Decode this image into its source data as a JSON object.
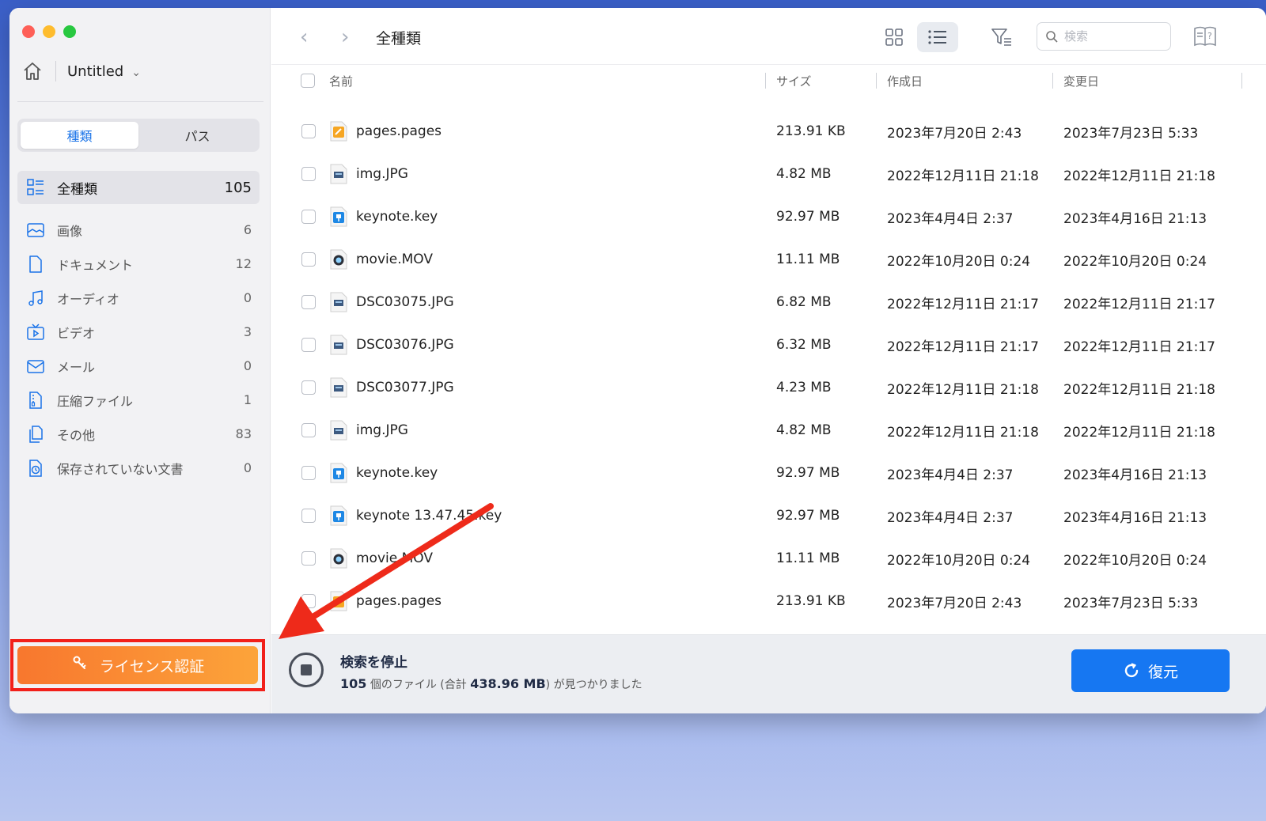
{
  "window": {
    "title": "Untitled"
  },
  "sidebar": {
    "segments": [
      {
        "label": "種類",
        "active": true
      },
      {
        "label": "パス",
        "active": false
      }
    ],
    "categories": [
      {
        "label": "全種類",
        "count": "105",
        "icon": "all-types-icon"
      },
      {
        "label": "画像",
        "count": "6",
        "icon": "image-icon"
      },
      {
        "label": "ドキュメント",
        "count": "12",
        "icon": "document-icon"
      },
      {
        "label": "オーディオ",
        "count": "0",
        "icon": "music-note-icon"
      },
      {
        "label": "ビデオ",
        "count": "3",
        "icon": "video-icon"
      },
      {
        "label": "メール",
        "count": "0",
        "icon": "mail-icon"
      },
      {
        "label": "圧縮ファイル",
        "count": "1",
        "icon": "archive-icon"
      },
      {
        "label": "その他",
        "count": "83",
        "icon": "other-files-icon"
      },
      {
        "label": "保存されていない文書",
        "count": "0",
        "icon": "unsaved-document-icon"
      }
    ],
    "license_label": "ライセンス認証"
  },
  "toolbar": {
    "breadcrumb": "全種類",
    "search_placeholder": "検索"
  },
  "table": {
    "headers": {
      "name": "名前",
      "size": "サイズ",
      "created": "作成日",
      "modified": "変更日"
    },
    "rows": [
      {
        "name": "pages.pages",
        "size": "213.91 KB",
        "created": "2023年7月20日 2:43",
        "modified": "2023年7月23日 5:33",
        "type": "pages"
      },
      {
        "name": "img.JPG",
        "size": "4.82 MB",
        "created": "2022年12月11日 21:18",
        "modified": "2022年12月11日 21:18",
        "type": "image"
      },
      {
        "name": "keynote.key",
        "size": "92.97 MB",
        "created": "2023年4月4日 2:37",
        "modified": "2023年4月16日 21:13",
        "type": "keynote"
      },
      {
        "name": "movie.MOV",
        "size": "11.11 MB",
        "created": "2022年10月20日 0:24",
        "modified": "2022年10月20日 0:24",
        "type": "movie"
      },
      {
        "name": "DSC03075.JPG",
        "size": "6.82 MB",
        "created": "2022年12月11日 21:17",
        "modified": "2022年12月11日 21:17",
        "type": "image"
      },
      {
        "name": "DSC03076.JPG",
        "size": "6.32 MB",
        "created": "2022年12月11日 21:17",
        "modified": "2022年12月11日 21:17",
        "type": "image"
      },
      {
        "name": "DSC03077.JPG",
        "size": "4.23 MB",
        "created": "2022年12月11日 21:18",
        "modified": "2022年12月11日 21:18",
        "type": "image"
      },
      {
        "name": "img.JPG",
        "size": "4.82 MB",
        "created": "2022年12月11日 21:18",
        "modified": "2022年12月11日 21:18",
        "type": "image"
      },
      {
        "name": "keynote.key",
        "size": "92.97 MB",
        "created": "2023年4月4日 2:37",
        "modified": "2023年4月16日 21:13",
        "type": "keynote"
      },
      {
        "name": "keynote 13.47.45.key",
        "size": "92.97 MB",
        "created": "2023年4月4日 2:37",
        "modified": "2023年4月16日 21:13",
        "type": "keynote"
      },
      {
        "name": "movie.MOV",
        "size": "11.11 MB",
        "created": "2022年10月20日 0:24",
        "modified": "2022年10月20日 0:24",
        "type": "movie"
      },
      {
        "name": "pages.pages",
        "size": "213.91 KB",
        "created": "2023年7月20日 2:43",
        "modified": "2023年7月23日 5:33",
        "type": "pages"
      }
    ]
  },
  "status": {
    "title": "検索を停止",
    "count": "105",
    "count_suffix": " 個のファイル (合計 ",
    "total": "438.96 MB",
    "tail": ") が見つかりました",
    "restore_label": "復元"
  },
  "colors": {
    "accent": "#1677f2",
    "license_from": "#f8772e",
    "license_to": "#fca43a",
    "highlight": "#f2201a"
  }
}
